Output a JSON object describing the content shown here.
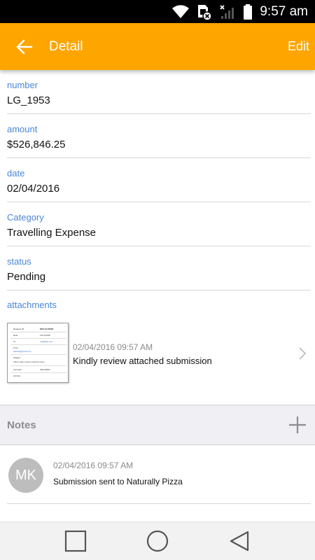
{
  "status_bar": {
    "time": "9:57 am",
    "icons": [
      "wifi-icon",
      "sim-blocked-icon",
      "no-signal-icon",
      "battery-icon"
    ]
  },
  "app_bar": {
    "back_icon": "arrow-left-icon",
    "title": "Detail",
    "edit_label": "Edit",
    "color": "#FFA500"
  },
  "fields": [
    {
      "label": "number",
      "value": "LG_1953"
    },
    {
      "label": "amount",
      "value": "$526,846.25"
    },
    {
      "label": "date",
      "value": "02/04/2016"
    },
    {
      "label": "Category",
      "value": "Travelling Expense"
    },
    {
      "label": "status",
      "value": "Pending"
    }
  ],
  "attachments": {
    "label": "attachments",
    "items": [
      {
        "date": "02/04/2016 09:57 AM",
        "description": "Kindly review attached submission",
        "thumbnail": {
          "lines": [
            [
              "Request ID",
              "MKT-M-53809"
            ],
            [
              "Date",
              "11/17/2015"
            ],
            [
              "To",
              "me@fast.com"
            ],
            [
              "From",
              ""
            ],
            [
              "",
              "abbasi@gmail.com"
            ],
            [
              "Subject",
              ""
            ],
            [
              "",
              "This is also a test e-mail for union"
            ],
            [
              "Ad Code",
              "VELO9401"
            ],
            [
              "Ad Size",
              ""
            ]
          ]
        }
      }
    ]
  },
  "notes": {
    "title": "Notes",
    "add_icon": "plus-icon",
    "items": [
      {
        "initials": "MK",
        "date": "02/04/2016 09:57 AM",
        "text": "Submission sent to Naturally Pizza"
      }
    ]
  },
  "nav_bar": {
    "buttons": [
      "recent-apps-icon",
      "home-icon",
      "back-triangle-icon"
    ]
  },
  "colors": {
    "accent": "#FFA500",
    "label_blue": "#4a86d9"
  }
}
